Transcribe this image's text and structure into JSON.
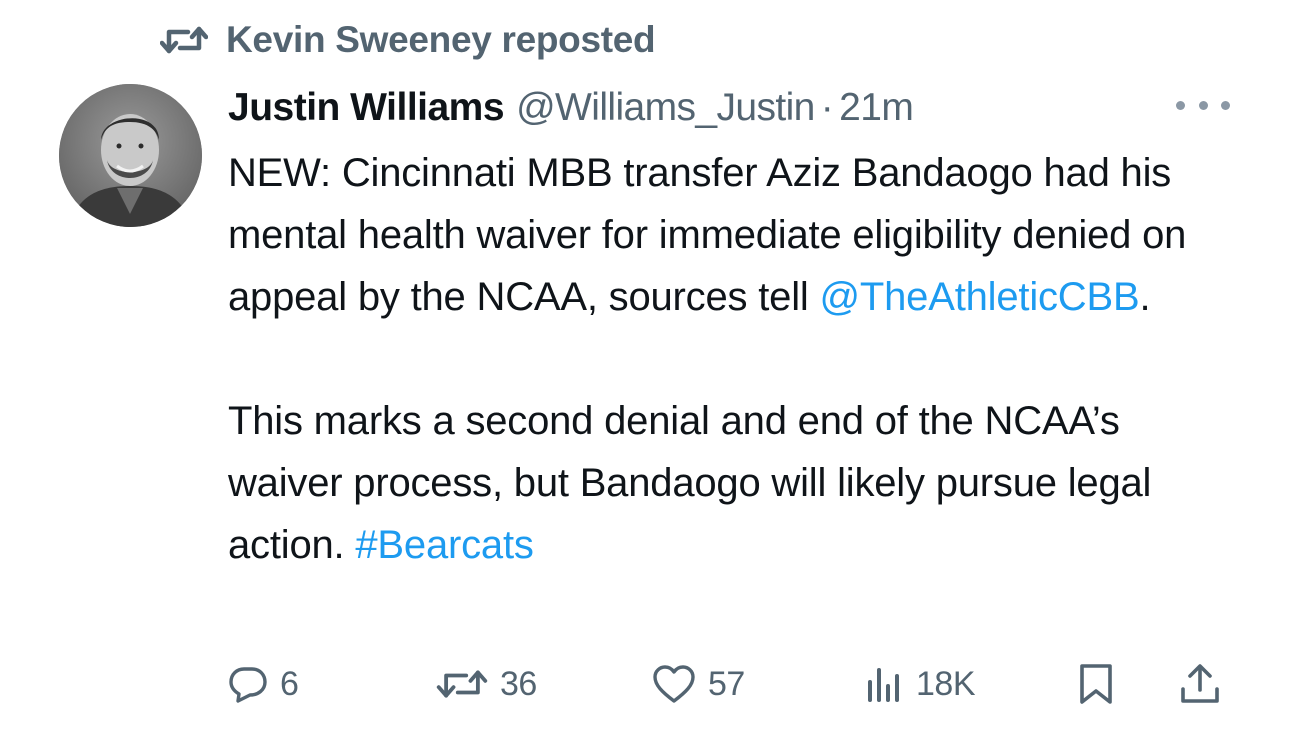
{
  "repost": {
    "icon": "repost-icon",
    "text": "Kevin Sweeney reposted"
  },
  "tweet": {
    "author_name": "Justin Williams",
    "author_handle": "@Williams_Justin",
    "separator": "·",
    "time": "21m",
    "more_icon": "more-options-icon",
    "paragraph1": {
      "text": "NEW: Cincinnati MBB transfer Aziz Bandaogo had his mental health waiver for immediate eligibility denied on appeal by the NCAA, sources tell ",
      "mention": "@TheAthleticCBB",
      "trailing": "."
    },
    "paragraph2": {
      "text": "This marks a second denial and end of the NCAA’s waiver process, but Bandaogo will likely pursue legal action. ",
      "hashtag": "#Bearcats"
    }
  },
  "actions": {
    "reply": {
      "icon": "reply-icon",
      "count": "6"
    },
    "retweet": {
      "icon": "retweet-icon",
      "count": "36"
    },
    "like": {
      "icon": "heart-icon",
      "count": "57"
    },
    "views": {
      "icon": "views-icon",
      "count": "18K"
    },
    "bookmark": {
      "icon": "bookmark-icon"
    },
    "share": {
      "icon": "share-icon"
    }
  },
  "colors": {
    "text": "#0f1419",
    "secondary": "#536471",
    "link": "#1d9bf0"
  }
}
